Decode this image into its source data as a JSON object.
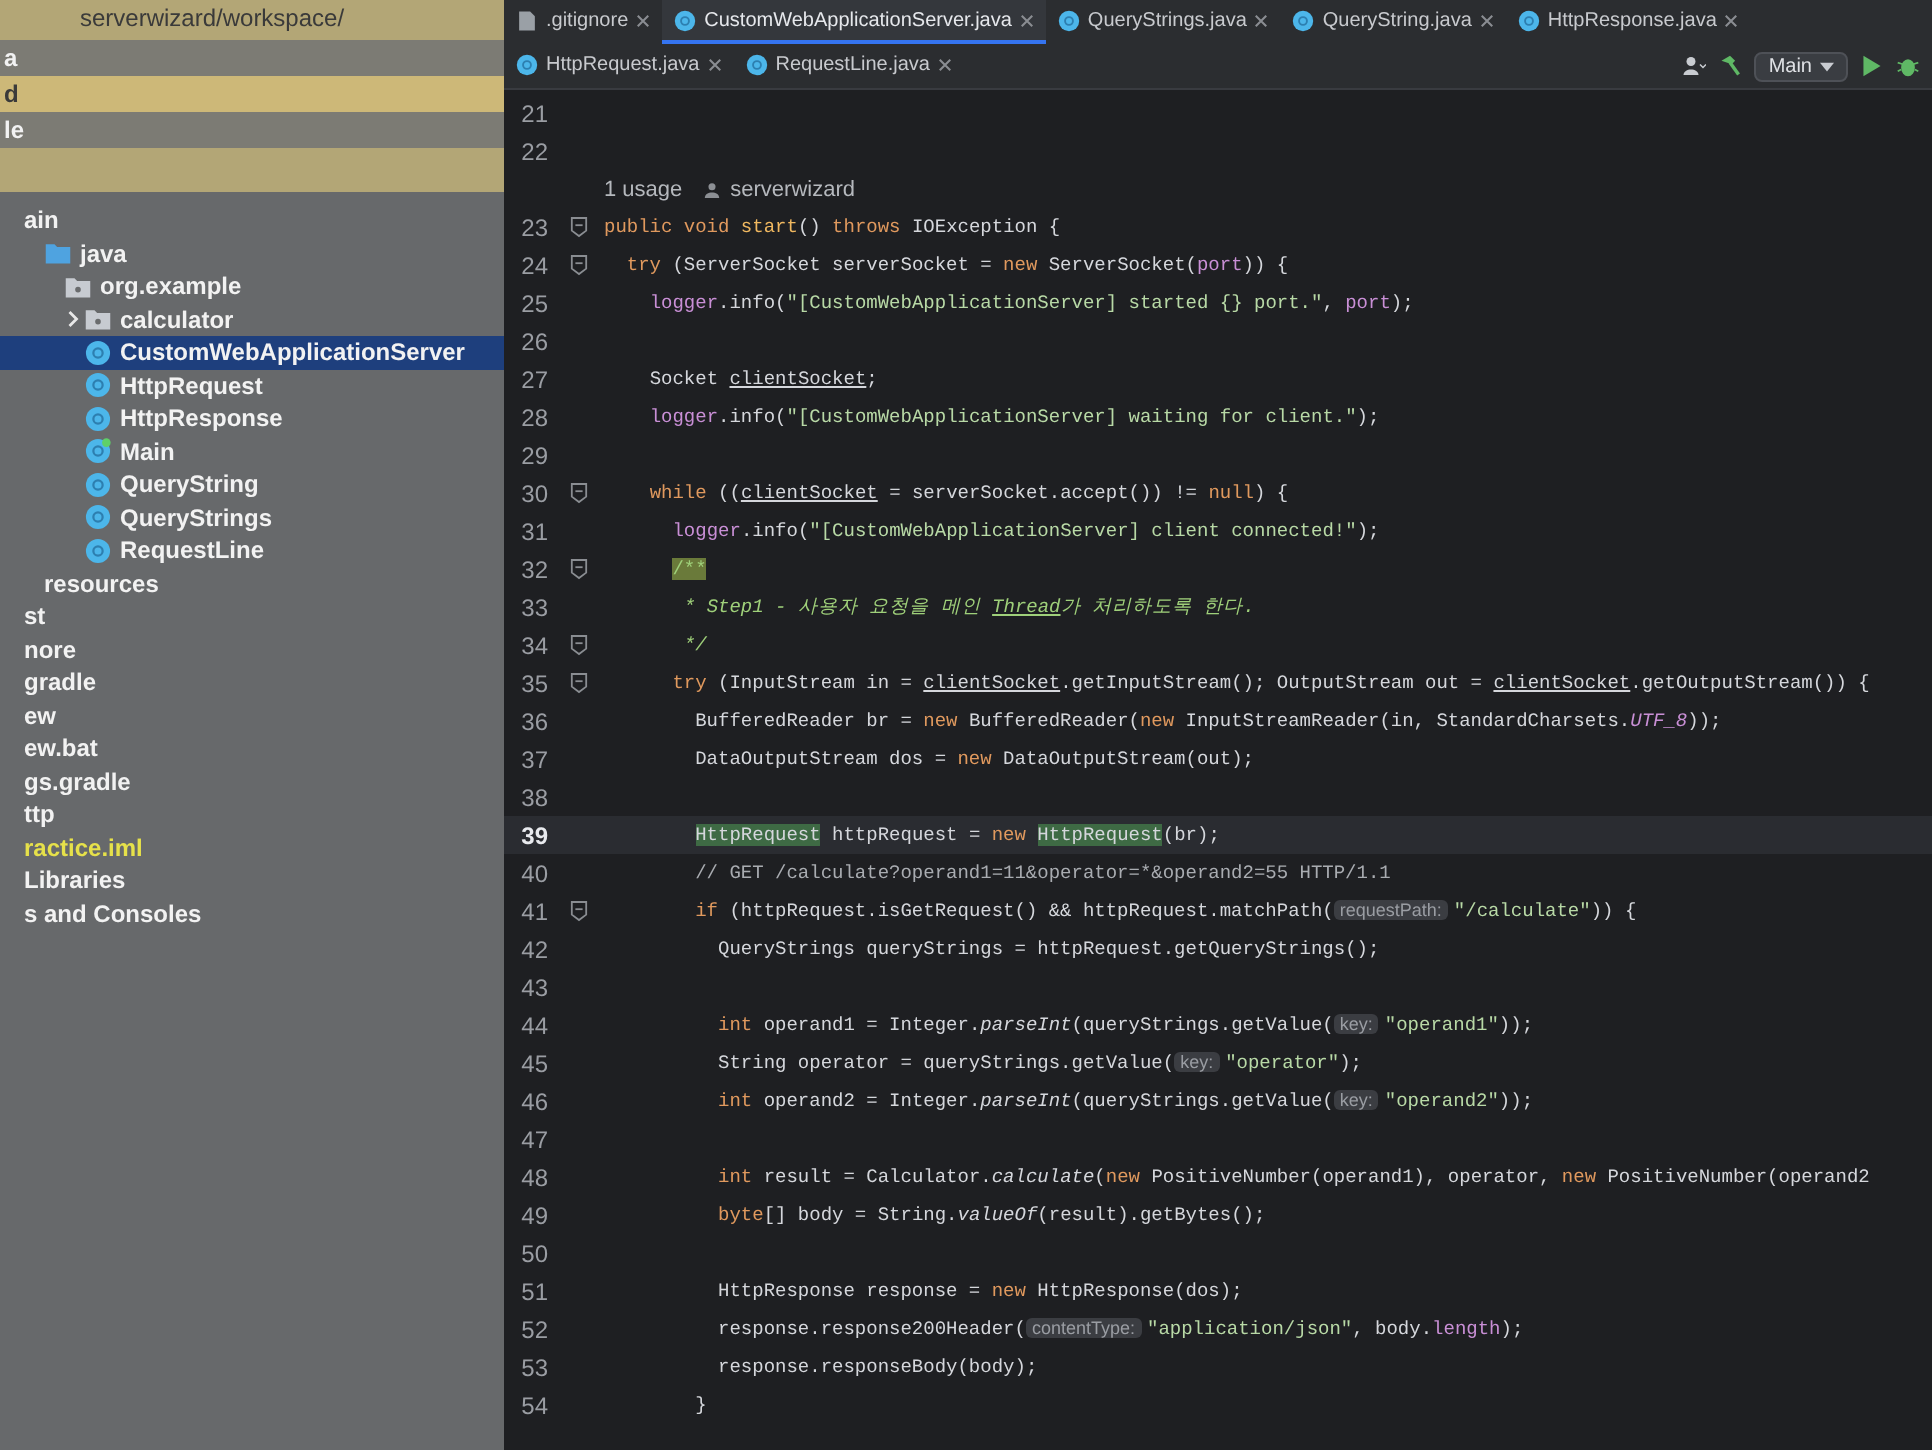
{
  "project_panel": {
    "path": "serverwizard/workspace/",
    "header_rows": [
      {
        "label": "a",
        "highlighted": false
      },
      {
        "label": "d",
        "highlighted": true
      },
      {
        "label": "le",
        "highlighted": false
      }
    ],
    "tree": [
      {
        "label": "ain",
        "kind": "text",
        "selected": false,
        "collapsed": false,
        "children": [
          {
            "label": "java",
            "kind": "source-root",
            "selected": false,
            "collapsed": false,
            "children": [
              {
                "label": "org.example",
                "kind": "package",
                "selected": false,
                "collapsed": false,
                "children": [
                  {
                    "label": "calculator",
                    "kind": "package",
                    "selected": false,
                    "collapsed": true
                  },
                  {
                    "label": "CustomWebApplicationServer",
                    "kind": "class",
                    "selected": true,
                    "collapsed": false
                  },
                  {
                    "label": "HttpRequest",
                    "kind": "class",
                    "selected": false,
                    "collapsed": false
                  },
                  {
                    "label": "HttpResponse",
                    "kind": "class",
                    "selected": false,
                    "collapsed": false
                  },
                  {
                    "label": "Main",
                    "kind": "main-class",
                    "selected": false,
                    "collapsed": false
                  },
                  {
                    "label": "QueryString",
                    "kind": "class",
                    "selected": false,
                    "collapsed": false
                  },
                  {
                    "label": "QueryStrings",
                    "kind": "class",
                    "selected": false,
                    "collapsed": false
                  },
                  {
                    "label": "RequestLine",
                    "kind": "class",
                    "selected": false,
                    "collapsed": false
                  }
                ]
              }
            ]
          },
          {
            "label": "resources",
            "kind": "text",
            "selected": false,
            "collapsed": false
          }
        ]
      },
      {
        "label": "st",
        "kind": "text",
        "selected": false,
        "collapsed": false
      },
      {
        "label": "nore",
        "kind": "text",
        "selected": false,
        "collapsed": false
      },
      {
        "label": "gradle",
        "kind": "text",
        "selected": false,
        "collapsed": false
      },
      {
        "label": "ew",
        "kind": "text",
        "selected": false,
        "collapsed": false
      },
      {
        "label": "ew.bat",
        "kind": "text",
        "selected": false,
        "collapsed": false
      },
      {
        "label": "gs.gradle",
        "kind": "text",
        "selected": false,
        "collapsed": false
      },
      {
        "label": "ttp",
        "kind": "text",
        "selected": false,
        "collapsed": false
      },
      {
        "label": "ractice.iml",
        "kind": "module-file",
        "selected": false,
        "collapsed": false
      },
      {
        "label": "Libraries",
        "kind": "text",
        "selected": false,
        "collapsed": false
      },
      {
        "label": "s and Consoles",
        "kind": "text",
        "selected": false,
        "collapsed": false
      }
    ]
  },
  "editor": {
    "tabs": [
      {
        "label": ".gitignore",
        "kind": "ignore-file",
        "selected": false
      },
      {
        "label": "CustomWebApplicationServer.java",
        "kind": "class",
        "selected": true
      },
      {
        "label": "QueryStrings.java",
        "kind": "class",
        "selected": false
      },
      {
        "label": "QueryString.java",
        "kind": "class",
        "selected": false
      },
      {
        "label": "HttpResponse.java",
        "kind": "class",
        "selected": false
      },
      {
        "label": "HttpRequest.java",
        "kind": "class",
        "selected": false
      },
      {
        "label": "RequestLine.java",
        "kind": "class",
        "selected": false
      }
    ],
    "toolbar": {
      "run_config": "Main"
    },
    "lines": [
      {
        "number": "21",
        "current": false,
        "fold": false
      },
      {
        "number": "22",
        "current": false,
        "fold": false
      },
      {
        "number": "23",
        "current": false,
        "fold": true,
        "inlay": {
          "usages": "1 usage",
          "author": "serverwizard"
        },
        "tokens": [
          {
            "kind": "kw",
            "text": "public void "
          },
          {
            "kind": "fn",
            "text": "start"
          },
          {
            "kind": "plain",
            "text": "() "
          },
          {
            "kind": "kw",
            "text": "throws "
          },
          {
            "kind": "plain",
            "text": "IOException {"
          }
        ]
      },
      {
        "number": "24",
        "current": false,
        "fold": true,
        "tokens": [
          {
            "kind": "kw",
            "text": "  try "
          },
          {
            "kind": "plain",
            "text": "(ServerSocket serverSocket = "
          },
          {
            "kind": "kw",
            "text": "new "
          },
          {
            "kind": "plain",
            "text": "ServerSocket("
          },
          {
            "kind": "field",
            "text": "port"
          },
          {
            "kind": "plain",
            "text": ")) {"
          }
        ]
      },
      {
        "number": "25",
        "current": false,
        "fold": false,
        "tokens": [
          {
            "kind": "field",
            "text": "    logger"
          },
          {
            "kind": "plain",
            "text": ".info("
          },
          {
            "kind": "str",
            "text": "\"[CustomWebApplicationServer] started {} port.\""
          },
          {
            "kind": "plain",
            "text": ", "
          },
          {
            "kind": "field",
            "text": "port"
          },
          {
            "kind": "plain",
            "text": ");"
          }
        ]
      },
      {
        "number": "26",
        "current": false,
        "fold": false
      },
      {
        "number": "27",
        "current": false,
        "fold": false,
        "tokens": [
          {
            "kind": "plain",
            "text": "    Socket "
          },
          {
            "kind": "ref",
            "text": "clientSocket"
          },
          {
            "kind": "plain",
            "text": ";"
          }
        ]
      },
      {
        "number": "28",
        "current": false,
        "fold": false,
        "tokens": [
          {
            "kind": "field",
            "text": "    logger"
          },
          {
            "kind": "plain",
            "text": ".info("
          },
          {
            "kind": "str",
            "text": "\"[CustomWebApplicationServer] waiting for client.\""
          },
          {
            "kind": "plain",
            "text": ");"
          }
        ]
      },
      {
        "number": "29",
        "current": false,
        "fold": false
      },
      {
        "number": "30",
        "current": false,
        "fold": true,
        "tokens": [
          {
            "kind": "kw",
            "text": "    while "
          },
          {
            "kind": "plain",
            "text": "(("
          },
          {
            "kind": "ref",
            "text": "clientSocket"
          },
          {
            "kind": "plain",
            "text": " = serverSocket.accept()) != "
          },
          {
            "kind": "kw",
            "text": "null"
          },
          {
            "kind": "plain",
            "text": ") {"
          }
        ]
      },
      {
        "number": "31",
        "current": false,
        "fold": false,
        "tokens": [
          {
            "kind": "field",
            "text": "      logger"
          },
          {
            "kind": "plain",
            "text": ".info("
          },
          {
            "kind": "str",
            "text": "\"[CustomWebApplicationServer] client connected!\""
          },
          {
            "kind": "plain",
            "text": ");"
          }
        ]
      },
      {
        "number": "32",
        "current": false,
        "fold": true,
        "tokens": [
          {
            "kind": "docopen",
            "text": "      /**"
          }
        ]
      },
      {
        "number": "33",
        "current": false,
        "fold": false,
        "tokens": [
          {
            "kind": "doc",
            "text": "       * Step1 - 사용자 요청을 메인 "
          },
          {
            "kind": "docref",
            "text": "Thread"
          },
          {
            "kind": "doc",
            "text": "가 처리하도록 한다."
          }
        ]
      },
      {
        "number": "34",
        "current": false,
        "fold": true,
        "tokens": [
          {
            "kind": "doc",
            "text": "       */"
          }
        ]
      },
      {
        "number": "35",
        "current": false,
        "fold": true,
        "tokens": [
          {
            "kind": "kw",
            "text": "      try "
          },
          {
            "kind": "plain",
            "text": "(InputStream in = "
          },
          {
            "kind": "ref",
            "text": "clientSocket"
          },
          {
            "kind": "plain",
            "text": ".getInputStream(); OutputStream out = "
          },
          {
            "kind": "ref",
            "text": "clientSocket"
          },
          {
            "kind": "plain",
            "text": ".getOutputStream()) {"
          }
        ]
      },
      {
        "number": "36",
        "current": false,
        "fold": false,
        "tokens": [
          {
            "kind": "plain",
            "text": "        BufferedReader br = "
          },
          {
            "kind": "kw",
            "text": "new "
          },
          {
            "kind": "plain",
            "text": "BufferedReader("
          },
          {
            "kind": "kw",
            "text": "new "
          },
          {
            "kind": "plain",
            "text": "InputStreamReader(in, StandardCharsets."
          },
          {
            "kind": "const",
            "text": "UTF_8"
          },
          {
            "kind": "plain",
            "text": "));"
          }
        ]
      },
      {
        "number": "37",
        "current": false,
        "fold": false,
        "tokens": [
          {
            "kind": "plain",
            "text": "        DataOutputStream dos = "
          },
          {
            "kind": "kw",
            "text": "new "
          },
          {
            "kind": "plain",
            "text": "DataOutputStream(out);"
          }
        ]
      },
      {
        "number": "38",
        "current": false,
        "fold": false
      },
      {
        "number": "39",
        "current": true,
        "fold": false,
        "tokens": [
          {
            "kind": "match",
            "text": "        HttpRequest"
          },
          {
            "kind": "plain",
            "text": " httpRequest = "
          },
          {
            "kind": "kw",
            "text": "new "
          },
          {
            "kind": "match",
            "text": "HttpRequest"
          },
          {
            "kind": "plain",
            "text": "(br);"
          }
        ]
      },
      {
        "number": "40",
        "current": false,
        "fold": false,
        "tokens": [
          {
            "kind": "comment",
            "text": "        // GET /calculate?operand1=11&operator=*&operand2=55 HTTP/1.1"
          }
        ]
      },
      {
        "number": "41",
        "current": false,
        "fold": true,
        "tokens": [
          {
            "kind": "kw",
            "text": "        if "
          },
          {
            "kind": "plain",
            "text": "(httpRequest.isGetRequest() && httpRequest.matchPath("
          },
          {
            "kind": "hint",
            "text": "requestPath:"
          },
          {
            "kind": "str",
            "text": "\"/calculate\""
          },
          {
            "kind": "plain",
            "text": ")) {"
          }
        ]
      },
      {
        "number": "42",
        "current": false,
        "fold": false,
        "tokens": [
          {
            "kind": "plain",
            "text": "          QueryStrings queryStrings = httpRequest.getQueryStrings();"
          }
        ]
      },
      {
        "number": "43",
        "current": false,
        "fold": false
      },
      {
        "number": "44",
        "current": false,
        "fold": false,
        "tokens": [
          {
            "kind": "kw",
            "text": "          int "
          },
          {
            "kind": "plain",
            "text": "operand1 = Integer."
          },
          {
            "kind": "static",
            "text": "parseInt"
          },
          {
            "kind": "plain",
            "text": "(queryStrings.getValue("
          },
          {
            "kind": "hint",
            "text": "key:"
          },
          {
            "kind": "str",
            "text": "\"operand1\""
          },
          {
            "kind": "plain",
            "text": "));"
          }
        ]
      },
      {
        "number": "45",
        "current": false,
        "fold": false,
        "tokens": [
          {
            "kind": "plain",
            "text": "          String operator = queryStrings.getValue("
          },
          {
            "kind": "hint",
            "text": "key:"
          },
          {
            "kind": "str",
            "text": "\"operator\""
          },
          {
            "kind": "plain",
            "text": ");"
          }
        ]
      },
      {
        "number": "46",
        "current": false,
        "fold": false,
        "tokens": [
          {
            "kind": "kw",
            "text": "          int "
          },
          {
            "kind": "plain",
            "text": "operand2 = Integer."
          },
          {
            "kind": "static",
            "text": "parseInt"
          },
          {
            "kind": "plain",
            "text": "(queryStrings.getValue("
          },
          {
            "kind": "hint",
            "text": "key:"
          },
          {
            "kind": "str",
            "text": "\"operand2\""
          },
          {
            "kind": "plain",
            "text": "));"
          }
        ]
      },
      {
        "number": "47",
        "current": false,
        "fold": false
      },
      {
        "number": "48",
        "current": false,
        "fold": false,
        "tokens": [
          {
            "kind": "kw",
            "text": "          int "
          },
          {
            "kind": "plain",
            "text": "result = Calculator."
          },
          {
            "kind": "static",
            "text": "calculate"
          },
          {
            "kind": "plain",
            "text": "("
          },
          {
            "kind": "kw",
            "text": "new "
          },
          {
            "kind": "plain",
            "text": "PositiveNumber(operand1), operator, "
          },
          {
            "kind": "kw",
            "text": "new "
          },
          {
            "kind": "plain",
            "text": "PositiveNumber(operand2"
          }
        ]
      },
      {
        "number": "49",
        "current": false,
        "fold": false,
        "tokens": [
          {
            "kind": "kw",
            "text": "          byte"
          },
          {
            "kind": "plain",
            "text": "[] body = String."
          },
          {
            "kind": "static",
            "text": "valueOf"
          },
          {
            "kind": "plain",
            "text": "(result).getBytes();"
          }
        ]
      },
      {
        "number": "50",
        "current": false,
        "fold": false
      },
      {
        "number": "51",
        "current": false,
        "fold": false,
        "tokens": [
          {
            "kind": "plain",
            "text": "          HttpResponse response = "
          },
          {
            "kind": "kw",
            "text": "new "
          },
          {
            "kind": "plain",
            "text": "HttpResponse(dos);"
          }
        ]
      },
      {
        "number": "52",
        "current": false,
        "fold": false,
        "tokens": [
          {
            "kind": "plain",
            "text": "          response.response200Header("
          },
          {
            "kind": "hint",
            "text": "contentType:"
          },
          {
            "kind": "str",
            "text": "\"application/json\""
          },
          {
            "kind": "plain",
            "text": ", body."
          },
          {
            "kind": "field",
            "text": "length"
          },
          {
            "kind": "plain",
            "text": ");"
          }
        ]
      },
      {
        "number": "53",
        "current": false,
        "fold": false,
        "tokens": [
          {
            "kind": "plain",
            "text": "          response.responseBody(body);"
          }
        ]
      },
      {
        "number": "54",
        "current": false,
        "fold": false,
        "tokens": [
          {
            "kind": "plain",
            "text": "        }"
          }
        ]
      }
    ]
  }
}
